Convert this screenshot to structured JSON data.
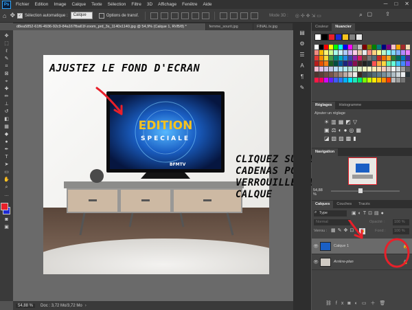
{
  "menu": [
    "Fichier",
    "Edition",
    "Image",
    "Calque",
    "Texte",
    "Sélection",
    "Filtre",
    "3D",
    "Affichage",
    "Fenêtre",
    "Aide"
  ],
  "app_logo": "Ps",
  "options": {
    "auto_select_label": "Sélection automatique :",
    "auto_select_value": "Calque",
    "transform_label": "Options de transf.",
    "mode_3d": "Mode 3D :"
  },
  "tabs": [
    "d8ea5852-61f6-4936-92c9-84a167fba61f-zoom_prd_3s_1140x1140.jpg @ 54,9% (Calque 1, RVB/8) *",
    "femme_sourit.jpg",
    "FINAL.tv.jpg"
  ],
  "status": {
    "zoom": "54,88 %",
    "doc": "Doc : 3,72 Mo/3,72 Mo"
  },
  "annotations": {
    "title": "AJUSTEZ LE FOND D'ECRAN",
    "hint_lines": [
      "CLIQUEZ SUR LE",
      "CADENAS POUR",
      "VERROUILLER LE",
      "CALQUE"
    ]
  },
  "tv": {
    "screen_text_1": "EDITION",
    "screen_text_2": "SPECIALE",
    "channel": "BFMTV"
  },
  "panels": {
    "color_tabs": [
      "Couleur",
      "Nuancier"
    ],
    "adjust_tabs": [
      "Réglages",
      "Histogramme"
    ],
    "adjust_hint": "Ajouter un réglage",
    "nav_tab": "Navigation",
    "nav_zoom": "54,88 %",
    "layer_tabs": [
      "Calques",
      "Couches",
      "Tracés"
    ],
    "filter_label": "Type",
    "blend_mode": "Normal",
    "opacity_label": "Opacité :",
    "opacity_value": "100 %",
    "lock_label": "Verrou :",
    "fill_label": "Fond :",
    "fill_value": "100 %",
    "layers": [
      {
        "name": "Calque 1"
      },
      {
        "name": "Arrière-plan"
      }
    ]
  },
  "colors": {
    "annotation_red": "#e8202a",
    "foreground": "#e8202a",
    "background": "#1e2bd6",
    "accent": "#31a8ff"
  }
}
